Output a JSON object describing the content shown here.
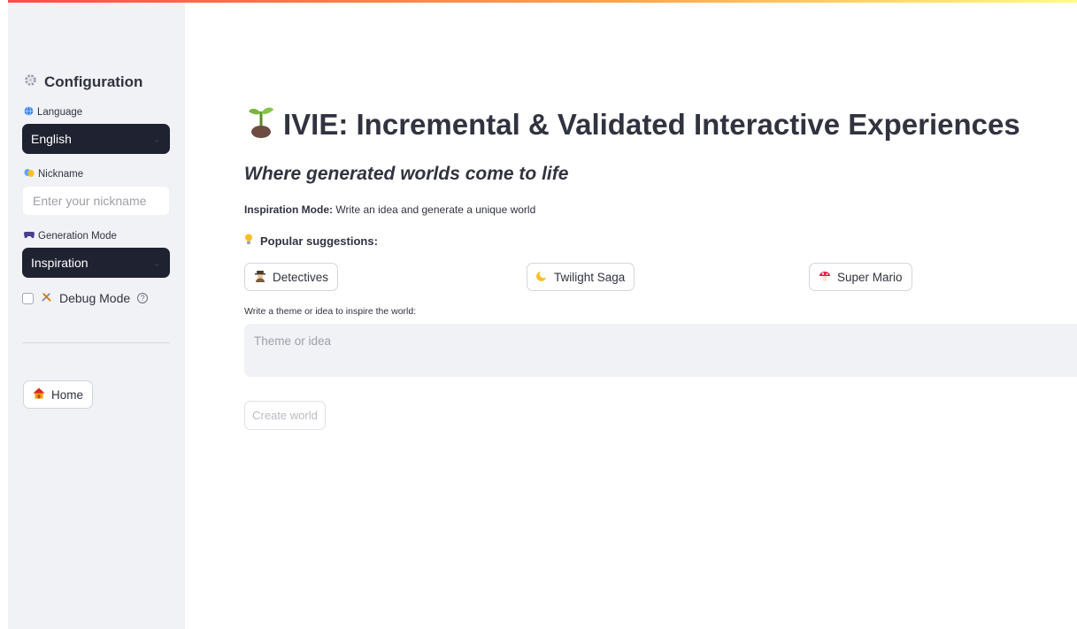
{
  "sidebar": {
    "title": "Configuration",
    "title_icon": "gear-icon",
    "language": {
      "label": "Language",
      "icon": "globe-icon",
      "value": "English"
    },
    "nickname": {
      "label": "Nickname",
      "icon": "masks-icon",
      "placeholder": "Enter your nickname"
    },
    "generation_mode": {
      "label": "Generation Mode",
      "icon": "gamepad-icon",
      "value": "Inspiration"
    },
    "debug": {
      "label": "Debug Mode",
      "icon": "tools-icon",
      "help": "?"
    },
    "home_button": {
      "label": "Home",
      "icon": "house-icon"
    }
  },
  "main": {
    "title": "IVIE: Incremental & Validated Interactive Experiences",
    "title_icon": "seedling-icon",
    "subtitle": "Where generated worlds come to life",
    "mode_bold": "Inspiration Mode:",
    "mode_text": " Write an idea and generate a unique world",
    "suggestions_label": "Popular suggestions:",
    "suggestions_icon": "lightbulb-icon",
    "suggestions": [
      {
        "label": "Detectives",
        "icon": "detective-icon"
      },
      {
        "label": "Twilight Saga",
        "icon": "moon-icon"
      },
      {
        "label": "Super Mario",
        "icon": "mushroom-icon"
      }
    ],
    "theme_label": "Write a theme or idea to inspire the world:",
    "theme_placeholder": "Theme or idea",
    "create_button": "Create world"
  },
  "colors": {
    "sidebar_bg": "#f0f2f6",
    "select_bg": "#1f2230",
    "text": "#31333f",
    "accent_gradient": [
      "#ff4b4b",
      "#ffa94b",
      "#fffd80"
    ]
  }
}
